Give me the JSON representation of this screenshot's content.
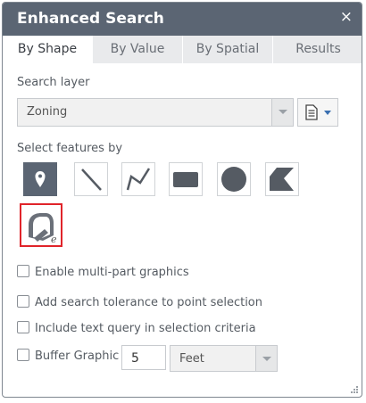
{
  "window": {
    "title": "Enhanced Search",
    "close_symbol": "×"
  },
  "tabs": [
    {
      "label": "By Shape",
      "active": true
    },
    {
      "label": "By Value",
      "active": false
    },
    {
      "label": "By Spatial",
      "active": false
    },
    {
      "label": "Results",
      "active": false
    }
  ],
  "search_layer": {
    "label": "Search layer",
    "selected": "Zoning"
  },
  "select_features": {
    "label": "Select features by",
    "tools": [
      {
        "name": "point-icon",
        "active": true
      },
      {
        "name": "line-icon",
        "active": false
      },
      {
        "name": "polyline-icon",
        "active": false
      },
      {
        "name": "extent-icon",
        "active": false
      },
      {
        "name": "circle-icon",
        "active": false
      },
      {
        "name": "polygon-icon",
        "active": false
      },
      {
        "name": "eraser-icon",
        "active": false,
        "highlighted": true
      }
    ]
  },
  "options": {
    "multipart": {
      "label": "Enable multi-part graphics",
      "checked": false
    },
    "tolerance": {
      "label": "Add search tolerance to point selection",
      "checked": false
    },
    "text_query": {
      "label": "Include text query in selection criteria",
      "checked": false
    },
    "buffer": {
      "label": "Buffer Graphic",
      "checked": false,
      "distance": "5",
      "unit": "Feet"
    }
  },
  "colors": {
    "header": "#5b6573",
    "highlight": "#e0242a"
  }
}
